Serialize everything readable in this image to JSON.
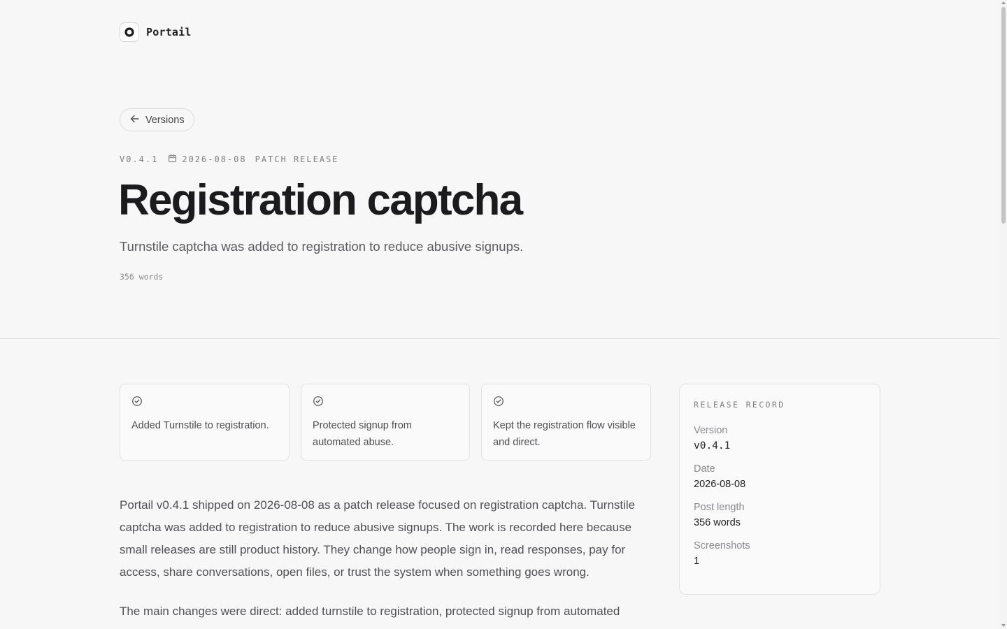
{
  "brand": {
    "name": "Portail",
    "logo_icon": "ring-logo-icon"
  },
  "nav": {
    "back_label": "Versions",
    "back_icon": "arrow-left-icon"
  },
  "post": {
    "version": "V0.4.1",
    "date": "2026-08-08",
    "date_icon": "calendar-icon",
    "kind": "PATCH RELEASE",
    "title": "Registration captcha",
    "subtitle": "Turnstile captcha was added to registration to reduce abusive signups.",
    "word_count": "356 words"
  },
  "highlights": [
    {
      "icon": "check-circle-icon",
      "text": "Added Turnstile to registration."
    },
    {
      "icon": "check-circle-icon",
      "text": "Protected signup from automated abuse."
    },
    {
      "icon": "check-circle-icon",
      "text": "Kept the registration flow visible and direct."
    }
  ],
  "body": {
    "paragraphs": [
      "Portail v0.4.1 shipped on 2026-08-08 as a patch release focused on registration captcha. Turnstile captcha was added to registration to reduce abusive signups. The work is recorded here because small releases are still product history. They change how people sign in, read responses, pay for access, share conversations, open files, or trust the system when something goes wrong.",
      "The main changes were direct: added turnstile to registration, protected signup from automated"
    ]
  },
  "record": {
    "title": "RELEASE RECORD",
    "rows": [
      {
        "label": "Version",
        "value": "v0.4.1"
      },
      {
        "label": "Date",
        "value": "2026-08-08"
      },
      {
        "label": "Post length",
        "value": "356 words"
      },
      {
        "label": "Screenshots",
        "value": "1"
      }
    ]
  }
}
